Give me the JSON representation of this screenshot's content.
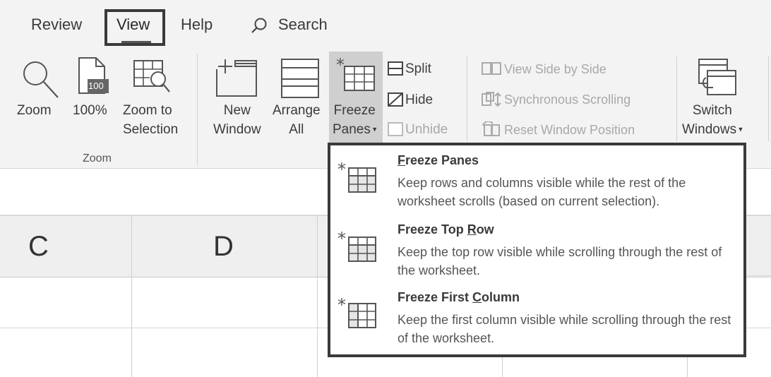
{
  "tabs": {
    "review": "Review",
    "view": "View",
    "help": "Help",
    "search": "Search"
  },
  "ribbon": {
    "zoom_group": {
      "zoom": "Zoom",
      "hundred": "100%",
      "zoom_to_line1": "Zoom to",
      "zoom_to_line2": "Selection",
      "page_icon_text": "100",
      "group_label": "Zoom"
    },
    "window_group": {
      "new_line1": "New",
      "new_line2": "Window",
      "arrange_line1": "Arrange",
      "arrange_line2": "All",
      "freeze_line1": "Freeze",
      "freeze_line2": "Panes",
      "split": "Split",
      "hide": "Hide",
      "unhide": "Unhide",
      "view_side_by_side": "View Side by Side",
      "sync_scrolling": "Synchronous Scrolling",
      "reset_position": "Reset Window Position",
      "switch_line1": "Switch",
      "switch_line2": "Windows"
    }
  },
  "sheet": {
    "columns": [
      "C",
      "D"
    ]
  },
  "freeze_menu": {
    "items": [
      {
        "title_pre": "",
        "title_u": "F",
        "title_post": "reeze Panes",
        "desc": "Keep rows and columns visible while the rest of the worksheet scrolls (based on current selection)."
      },
      {
        "title_pre": "Freeze Top ",
        "title_u": "R",
        "title_post": "ow",
        "desc": "Keep the top row visible while scrolling through the rest of the worksheet."
      },
      {
        "title_pre": "Freeze First ",
        "title_u": "C",
        "title_post": "olumn",
        "desc": "Keep the first column visible while scrolling through the rest of the worksheet."
      }
    ]
  },
  "icons": {
    "search": "search-icon",
    "zoom": "magnifier-icon",
    "hundred": "page-100-icon",
    "zoom_to_selection": "zoom-selection-icon",
    "new_window": "new-window-icon",
    "arrange_all": "arrange-all-icon",
    "freeze_panes": "freeze-panes-icon",
    "split": "split-icon",
    "hide": "hide-icon",
    "unhide": "unhide-icon",
    "side_by_side": "side-by-side-icon",
    "sync_scroll": "sync-scroll-icon",
    "reset_position": "reset-position-icon",
    "switch_windows": "switch-windows-icon"
  },
  "colors": {
    "ribbon_bg": "#f3f3f3",
    "highlight": "#cfcfcf",
    "menu_border": "#3a3a3a",
    "disabled_text": "#a8a8a8"
  }
}
